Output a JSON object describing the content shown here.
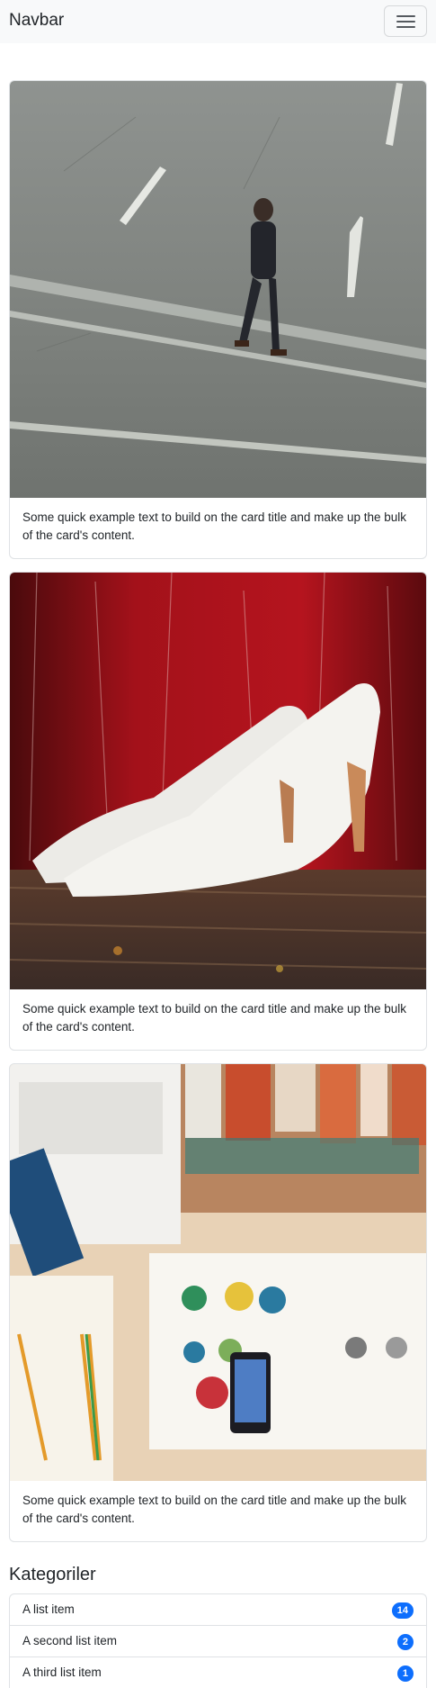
{
  "navbar": {
    "brand": "Navbar",
    "toggler_icon": "hamburger-menu-icon"
  },
  "cards": [
    {
      "image": "man-walking-on-street-photo",
      "text": "Some quick example text to build on the card title and make up the bulk of the card's content."
    },
    {
      "image": "white-high-heels-red-wall-photo",
      "text": "Some quick example text to build on the card title and make up the bulk of the card's content."
    },
    {
      "image": "desk-laptop-books-phone-photo",
      "text": "Some quick example text to build on the card title and make up the bulk of the card's content."
    }
  ],
  "categories": {
    "title": "Kategoriler",
    "items": [
      {
        "label": "A list item",
        "badge": "14"
      },
      {
        "label": "A second list item",
        "badge": "2"
      },
      {
        "label": "A third list item",
        "badge": "1"
      }
    ]
  },
  "colors": {
    "navbar_bg": "#f8f9fa",
    "badge_bg": "#0d6efd",
    "border": "#dfe2e5"
  }
}
